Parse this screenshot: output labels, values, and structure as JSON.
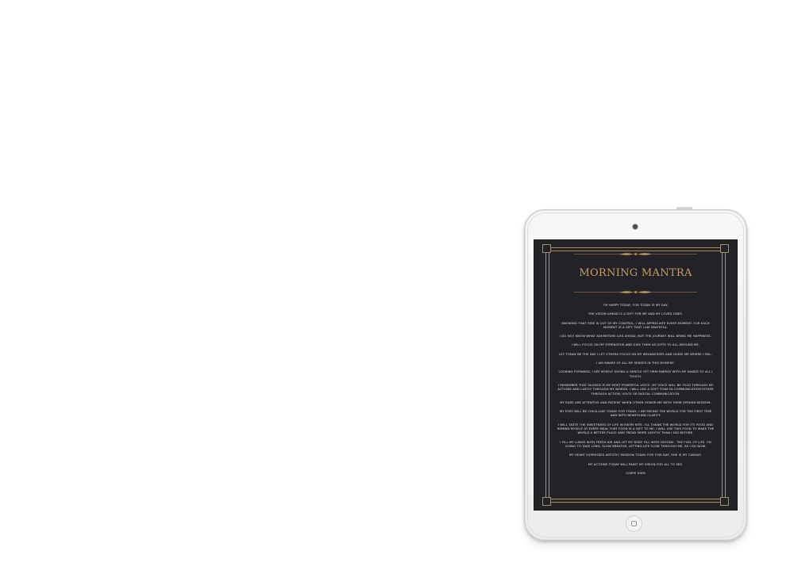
{
  "document": {
    "title": "MORNING MANTRA",
    "lines": [
      "I'M HAPPY TODAY, FOR TODAY IS MY DAY.",
      "THE VISION AHEAD IS A GIFT FOR ME AND MY LOVED ONES.",
      "KNOWING THAT TIME IS OUT OF MY CONTROL, I WILL APPRECIATE EVERY MOMENT. FOR EACH MOMENT IS A GIFT THAT I AM GRATEFUL.",
      "I DO NOT KNOW WHAT ADVENTURE LIES AHEAD, BUT THE JOURNEY WILL BRING ME HAPPINESS.",
      "I WILL FOCUS ON MY STRENGTHS AND GIVE THEM AS GIFTS TO ALL AROUND ME.",
      "LET TODAY BE THE DAY I LET OTHERS FOCUS ON MY WEAKNESSES AND GUIDE ME WHERE I FAIL.",
      "I AM AWARE OF ALL MY SENSES IN THIS MOMENT.",
      "LOOKING FORWARD, I SEE MYSELF GIVING A GENTLE YET FIRM ENERGY WITH MY HANDS TO ALL I TOUCH.",
      "I REMEMBER THAT SILENCE IS MY MOST POWERFUL VOICE. MY VOICE WILL BE TOLD THROUGH MY ACTIONS AND LASTLY THROUGH MY WORDS. I WILL USE A SOFT TONE IN COMMUNICATION EITHER THROUGH ACTION, VOICE OR DIGITAL COMMUNICATION.",
      "MY EARS ARE ATTENTIVE AND PATIENT WHEN OTHER HONOR ME WITH THEIR SPOKEN WISDOM.",
      "MY EYES WILL BE CHILD-LIKE TODAY. FOR TODAY, I AM SEEING THE WORLD FOR THE FIRST TIME AND WITH NEWFOUND CLARITY.",
      "I WILL TASTE THE SWEETNESS OF LIFE IN EVERY BITE. I'LL THANK THE WORLD FOR ITS FOOD AND REMIND MYSELF AT EVERY MEAL THAT FOOD IS A GIFT TO ME. I WILL USE THIS FOOD TO MAKE THE WORLD A BETTER PLACE AND TREAD MORE LIGHTLY THAN I DID BEFORE.",
      "I FILL MY LUNGS WITH FRESH AIR AND LET MY BODY FILL WITH OXYGEN - THE FUEL OF LIFE. I'M GOING TO TAKE LONG, SLOW BREATHS, LETTING LIFE FLOW THROUGH ME, AS I DO NOW.",
      "MY HEART EXPRESSES ARTISTIC PASSION TODAY. FOR THIS DAY, SHE IS MY CANVAS.",
      "MY ACTIONS TODAY WILL PAINT MY VISION FOR ALL TO SEE.",
      "CARPE DIEM"
    ]
  },
  "colors": {
    "screen_background": "#232327",
    "accent_gold": "#b08a5a",
    "title_gold": "#c89d64",
    "text": "#e8e6e2",
    "device_body": "#f2f2f2"
  },
  "icons": {
    "camera": "camera-icon",
    "home_button": "home-button-icon"
  }
}
